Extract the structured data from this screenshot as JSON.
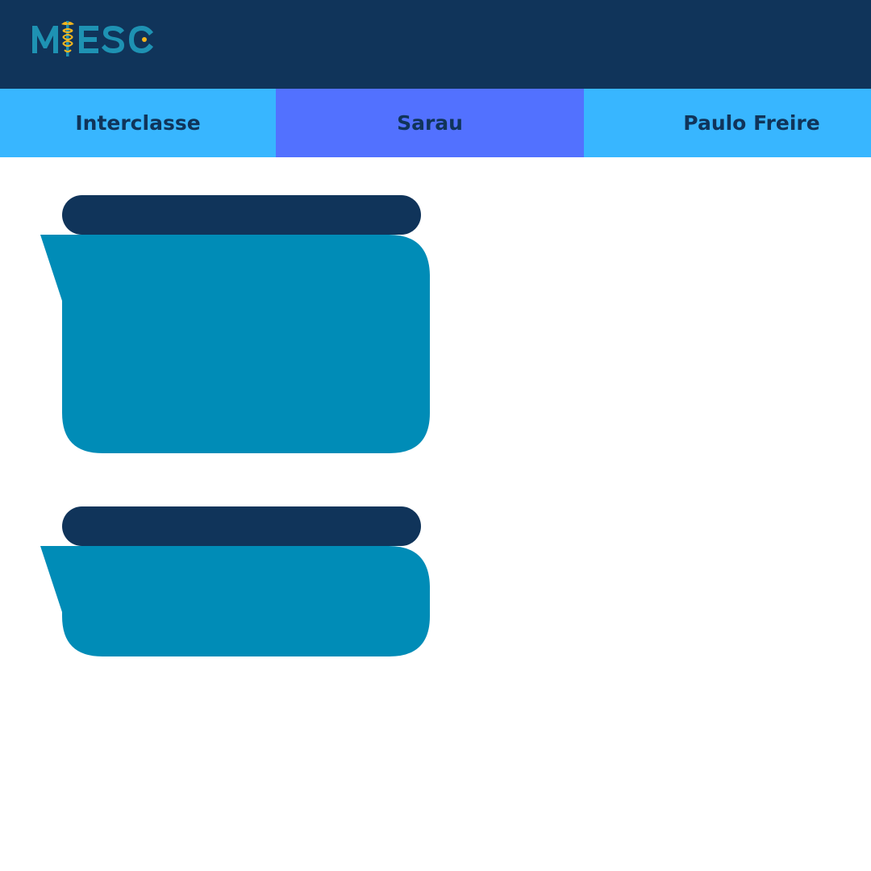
{
  "colors": {
    "header_bg": "#10345a",
    "tab_default_bg": "#38b6ff",
    "tab_active_bg": "#5271ff",
    "tab_text": "#10345a",
    "card_header_bg": "#10345a",
    "card_body_bg": "#008cb7",
    "logo_letters": "#1e92b3",
    "logo_accent": "#f2b51d"
  },
  "header": {
    "logo": {
      "text": "MIESC",
      "icon": "caduceus-icon"
    }
  },
  "nav": {
    "tabs": [
      {
        "label": "Interclasse",
        "active": false
      },
      {
        "label": "Sarau",
        "active": true
      },
      {
        "label": "Paulo Freire",
        "active": false
      }
    ]
  }
}
